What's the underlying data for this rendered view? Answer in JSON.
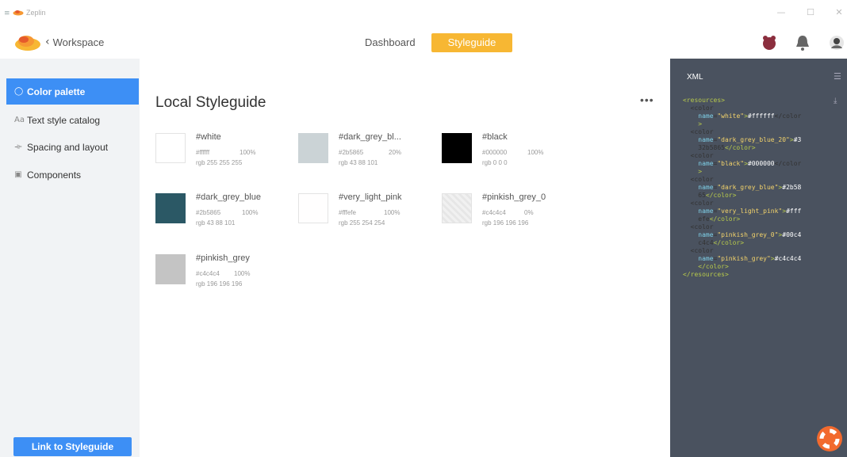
{
  "window": {
    "app_name": "Zeplin",
    "menu_icon": "hamburger-icon",
    "controls": {
      "minimize": "—",
      "maximize": "☐",
      "close": "✕"
    }
  },
  "header": {
    "back_label": "Workspace",
    "tabs": [
      {
        "label": "Dashboard",
        "active": false
      },
      {
        "label": "Styleguide",
        "active": true
      }
    ],
    "icons": [
      "avatar-bug-icon",
      "notification-bell-icon",
      "user-avatar-icon"
    ]
  },
  "sidebar": {
    "items": [
      {
        "icon": "◯",
        "label": "Color palette",
        "active": true
      },
      {
        "icon": "Aa",
        "label": "Text style catalog",
        "active": false
      },
      {
        "icon": "⟛",
        "label": "Spacing and layout",
        "active": false
      },
      {
        "icon": "▣",
        "label": "Components",
        "active": false
      }
    ],
    "link_button": "Link to Styleguide"
  },
  "main": {
    "title": "Local Styleguide",
    "more": "•••",
    "colors": [
      {
        "name": "#white",
        "hex": "#ffffff",
        "opacity": "100%",
        "rgb": "rgb 255 255 255",
        "color": "#ffffff"
      },
      {
        "name": "#dark_grey_bl...",
        "hex": "#2b5865",
        "opacity": "20%",
        "rgb": "rgb 43 88 101",
        "color": "#cbd3d6"
      },
      {
        "name": "#black",
        "hex": "#000000",
        "opacity": "100%",
        "rgb": "rgb 0 0 0",
        "color": "#000000"
      },
      {
        "name": "#dark_grey_blue",
        "hex": "#2b5865",
        "opacity": "100%",
        "rgb": "rgb 43 88 101",
        "color": "#2b5865"
      },
      {
        "name": "#very_light_pink",
        "hex": "#fffefe",
        "opacity": "100%",
        "rgb": "rgb 255 254 254",
        "color": "#fffefe"
      },
      {
        "name": "#pinkish_grey_0",
        "hex": "#c4c4c4",
        "opacity": "0%",
        "rgb": "rgb 196 196 196",
        "color": "#eeeeee"
      },
      {
        "name": "#pinkish_grey",
        "hex": "#c4c4c4",
        "opacity": "100%",
        "rgb": "rgb 196 196 196",
        "color": "#c4c4c4"
      }
    ]
  },
  "xml": {
    "title": "XML",
    "lines": [
      "<resources>",
      "  <color",
      "    name=\"white\">#ffffff</color",
      "    >",
      "  <color",
      "    name=\"dark_grey_blue_20\">#3",
      "    32b5865</color>",
      "  <color",
      "    name=\"black\">#000000</color",
      "    >",
      "  <color",
      "    name=\"dark_grey_blue\">#2b58",
      "    65</color>",
      "  <color",
      "    name=\"very_light_pink\">#fff",
      "    efe</color>",
      "  <color",
      "    name=\"pinkish_grey_0\">#00c4",
      "    c4c4</color>",
      "  <color",
      "    name=\"pinkish_grey\">#c4c4c4",
      "    </color>",
      "</resources>"
    ]
  },
  "colors": {
    "accent_blue": "#3d8ff5",
    "accent_orange": "#f7b733",
    "panel_dark": "#4a525f"
  }
}
